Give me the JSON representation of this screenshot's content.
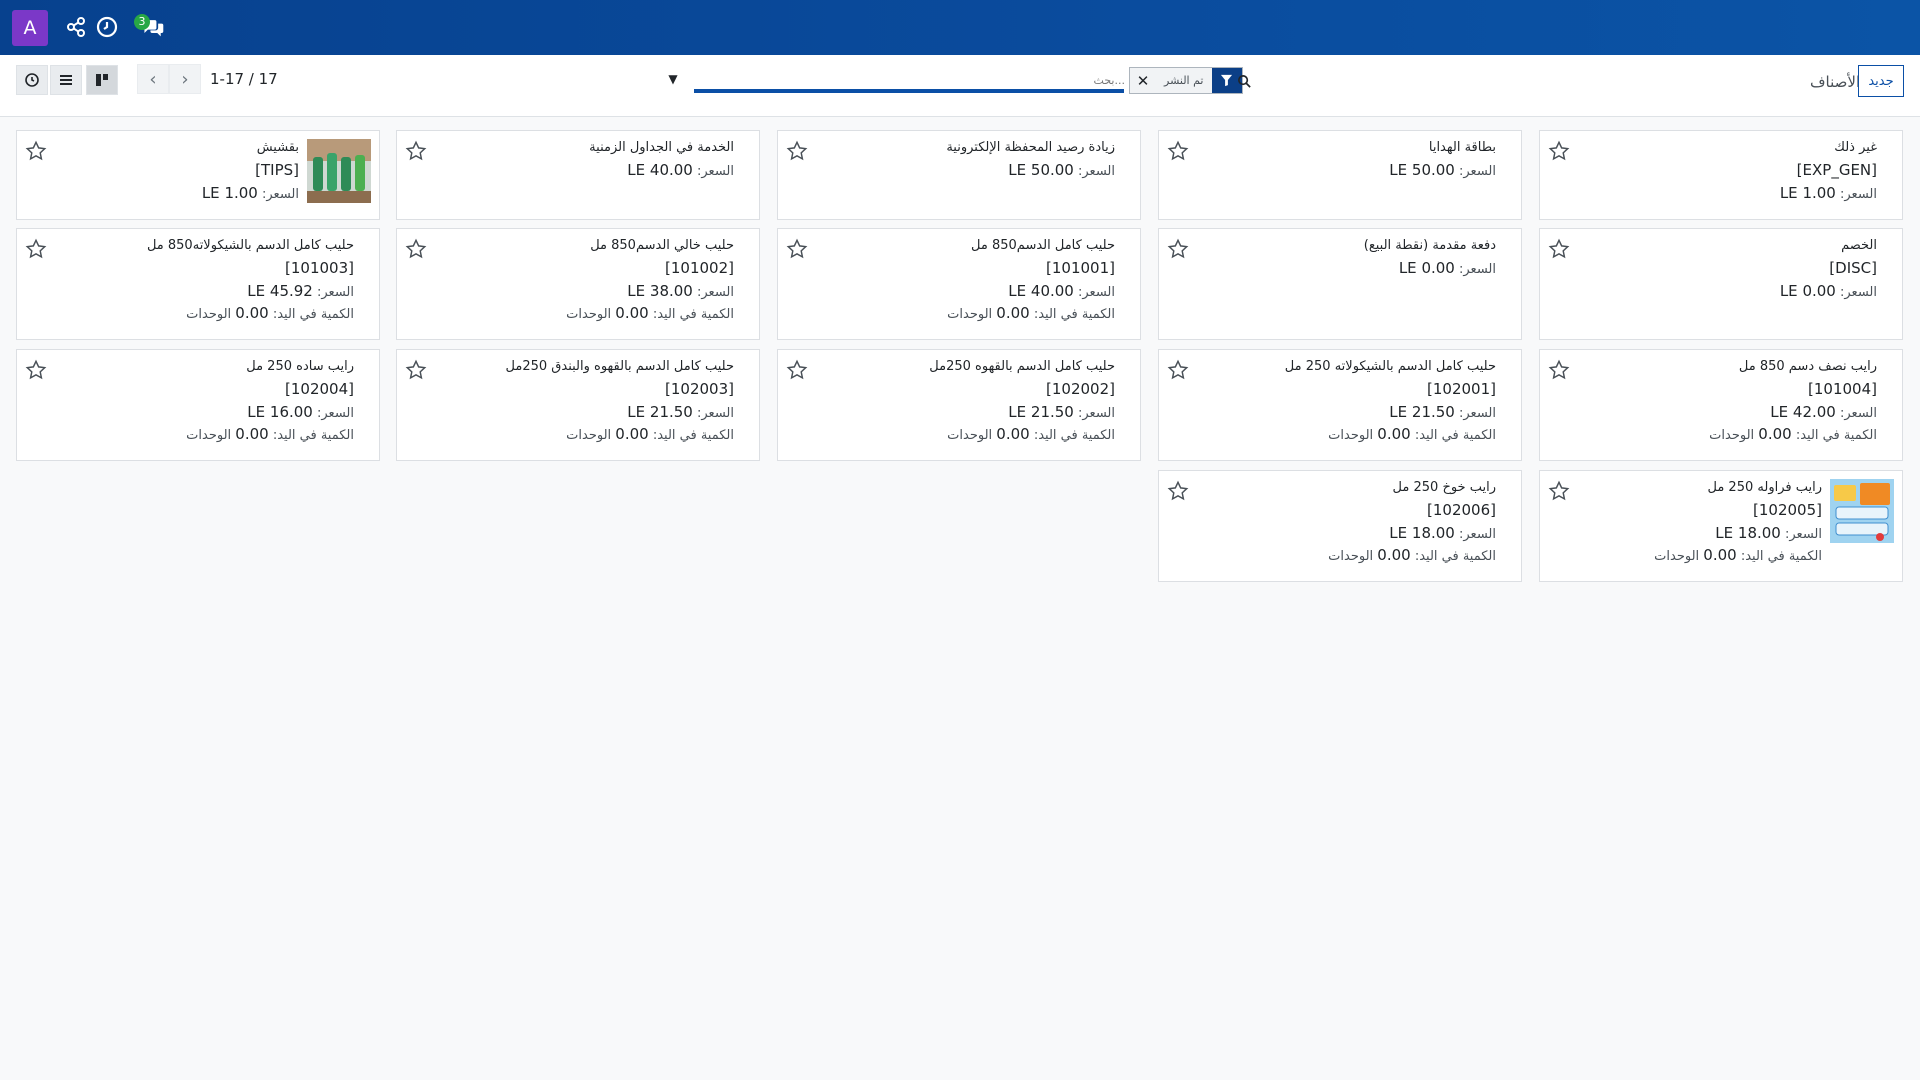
{
  "navbar": {
    "avatar_letter": "A",
    "icons": [
      "share-icon",
      "clock-icon",
      "chat-icon"
    ],
    "messages_badge": "3",
    "color": "#07418e"
  },
  "control": {
    "breadcrumb": "الأصناف",
    "new_button": "جديد",
    "search_placeholder": "بحث...",
    "facet_value": "تم النشر",
    "pager_value": "1-17 / 17"
  },
  "cards": [
    {
      "name": "غير ذلك",
      "code": "[EXP_GEN]",
      "price_label": "السعر:",
      "price": "1.00 LE",
      "qty": null
    },
    {
      "name": "بطاقة الهدايا",
      "code": null,
      "price_label": "السعر:",
      "price": "50.00 LE",
      "qty": null
    },
    {
      "name": "زيادة رصيد المحفظة الإلكترونية",
      "code": null,
      "price_label": "السعر:",
      "price": "50.00 LE",
      "qty": null
    },
    {
      "name": "الخدمة في الجداول الزمنية",
      "code": null,
      "price_label": "السعر:",
      "price": "40.00 LE",
      "qty": null
    },
    {
      "name": "بقشيش",
      "code": "[TIPS]",
      "price_label": "السعر:",
      "price": "1.00 LE",
      "qty": null,
      "image": "tips-product-image"
    },
    {
      "name": "الخصم",
      "code": "[DISC]",
      "price_label": "السعر:",
      "price": "0.00 LE",
      "qty": null
    },
    {
      "name": "دفعة مقدمة (نقطة البيع)",
      "code": null,
      "price_label": "السعر:",
      "price": "0.00 LE",
      "qty": null
    },
    {
      "name": "حليب كامل الدسم850 مل",
      "code": "[101001]",
      "price_label": "السعر:",
      "price": "40.00 LE",
      "qty_label": "الكمية في اليد:",
      "qty": "0.00",
      "qty_unit": "الوحدات"
    },
    {
      "name": "حليب خالي الدسم850 مل",
      "code": "[101002]",
      "price_label": "السعر:",
      "price": "38.00 LE",
      "qty_label": "الكمية في اليد:",
      "qty": "0.00",
      "qty_unit": "الوحدات"
    },
    {
      "name": "حليب كامل الدسم بالشيكولاته850 مل",
      "code": "[101003]",
      "price_label": "السعر:",
      "price": "45.92 LE",
      "qty_label": "الكمية في اليد:",
      "qty": "0.00",
      "qty_unit": "الوحدات"
    },
    {
      "name": "رايب نصف دسم 850 مل",
      "code": "[101004]",
      "price_label": "السعر:",
      "price": "42.00 LE",
      "qty_label": "الكمية في اليد:",
      "qty": "0.00",
      "qty_unit": "الوحدات"
    },
    {
      "name": "حليب كامل الدسم بالشيكولاته 250 مل",
      "code": "[102001]",
      "price_label": "السعر:",
      "price": "21.50 LE",
      "qty_label": "الكمية في اليد:",
      "qty": "0.00",
      "qty_unit": "الوحدات"
    },
    {
      "name": "حليب كامل الدسم بالقهوه 250مل",
      "code": "[102002]",
      "price_label": "السعر:",
      "price": "21.50 LE",
      "qty_label": "الكمية في اليد:",
      "qty": "0.00",
      "qty_unit": "الوحدات"
    },
    {
      "name": "حليب كامل الدسم بالقهوه والبندق 250مل",
      "code": "[102003]",
      "price_label": "السعر:",
      "price": "21.50 LE",
      "qty_label": "الكمية في اليد:",
      "qty": "0.00",
      "qty_unit": "الوحدات"
    },
    {
      "name": "رايب ساده 250 مل",
      "code": "[102004]",
      "price_label": "السعر:",
      "price": "16.00 LE",
      "qty_label": "الكمية في اليد:",
      "qty": "0.00",
      "qty_unit": "الوحدات"
    },
    {
      "name": "رايب فراوله 250 مل",
      "code": "[102005]",
      "price_label": "السعر:",
      "price": "18.00 LE",
      "qty_label": "الكمية في اليد:",
      "qty": "0.00",
      "qty_unit": "الوحدات",
      "image": "strawberry-yogurt-image"
    },
    {
      "name": "رايب خوخ 250 مل",
      "code": "[102006]",
      "price_label": "السعر:",
      "price": "18.00 LE",
      "qty_label": "الكمية في اليد:",
      "qty": "0.00",
      "qty_unit": "الوحدات"
    }
  ]
}
